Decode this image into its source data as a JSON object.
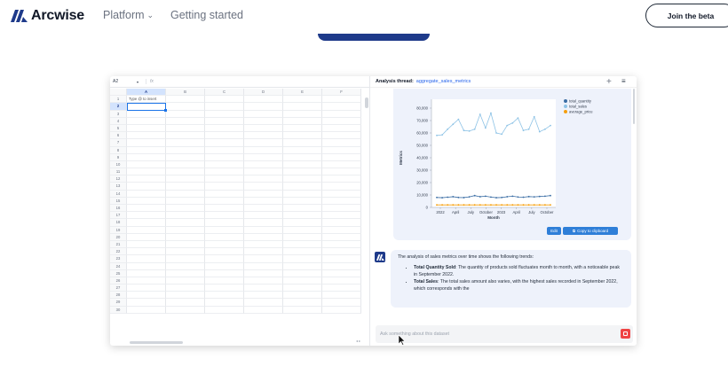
{
  "nav": {
    "brand": "Arcwise",
    "links": [
      {
        "label": "Platform",
        "has_dropdown": true
      },
      {
        "label": "Getting started",
        "has_dropdown": false
      }
    ],
    "cta": "Join the beta"
  },
  "colors": {
    "brand": "#1e3a8a",
    "accent_blue": "#2f7fd8",
    "total_quantity": "#3b6ea5",
    "total_sales": "#8ec3e6",
    "average_price": "#f59e0b",
    "stop": "#ef4444"
  },
  "spreadsheet": {
    "cell_ref": "A2",
    "fx_label": "fx",
    "columns": [
      "A",
      "B",
      "C",
      "D",
      "E",
      "F"
    ],
    "selected_column": "A",
    "selected_row": 2,
    "rows": 30,
    "cells": [
      {
        "row": 1,
        "col": "A",
        "value": "Type @ to insert"
      }
    ]
  },
  "panel": {
    "header_label": "Analysis thread:",
    "thread_name": "aggregate_sales_metrics",
    "add_icon": "plus-icon",
    "menu_icon": "hamburger-menu-icon",
    "edit_label": "Edit",
    "copy_label": "Copy to clipboard",
    "copy_icon": "copy-icon",
    "message": {
      "intro": "The analysis of sales metrics over time shows the following trends:",
      "bullets": [
        {
          "bold": "Total Quantity Sold",
          "text": ": The quantity of products sold fluctuates month to month, with a noticeable peak in September 2022."
        },
        {
          "bold": "Total Sales",
          "text": ": The total sales amount also varies, with the highest sales recorded in September 2022, which corresponds with the"
        }
      ]
    },
    "input_placeholder": "Ask something about this dataset",
    "stop_icon": "stop-icon"
  },
  "chart_data": {
    "type": "line",
    "xlabel": "Month",
    "ylabel": "Metrics",
    "yticks": [
      "0",
      "10,000",
      "20,000",
      "30,000",
      "40,000",
      "50,000",
      "60,000",
      "70,000",
      "80,000"
    ],
    "xtick_labels": [
      "2022",
      "April",
      "July",
      "October",
      "2023",
      "April",
      "July",
      "October"
    ],
    "ylim": [
      0,
      80000
    ],
    "legend_position": "top-right",
    "series": [
      {
        "name": "total_quantity",
        "values": [
          8000,
          7800,
          8200,
          8600,
          8000,
          7900,
          8500,
          9500,
          8600,
          9000,
          8300,
          7800,
          8000,
          8600,
          9000,
          8400,
          8200,
          8700,
          8500,
          8800,
          9000,
          9500
        ]
      },
      {
        "name": "total_sales",
        "values": [
          58000,
          58500,
          63000,
          67000,
          71000,
          62000,
          61500,
          63000,
          75000,
          64000,
          76000,
          60000,
          59000,
          66000,
          68000,
          72000,
          62000,
          63000,
          73000,
          61000,
          63000,
          66000
        ]
      },
      {
        "name": "average_price",
        "values": [
          2000,
          2000,
          2000,
          2000,
          2000,
          2000,
          2000,
          2000,
          2000,
          2000,
          2000,
          2000,
          2000,
          2000,
          2000,
          2000,
          2000,
          2000,
          2000,
          2000,
          2000,
          2000
        ]
      }
    ]
  }
}
